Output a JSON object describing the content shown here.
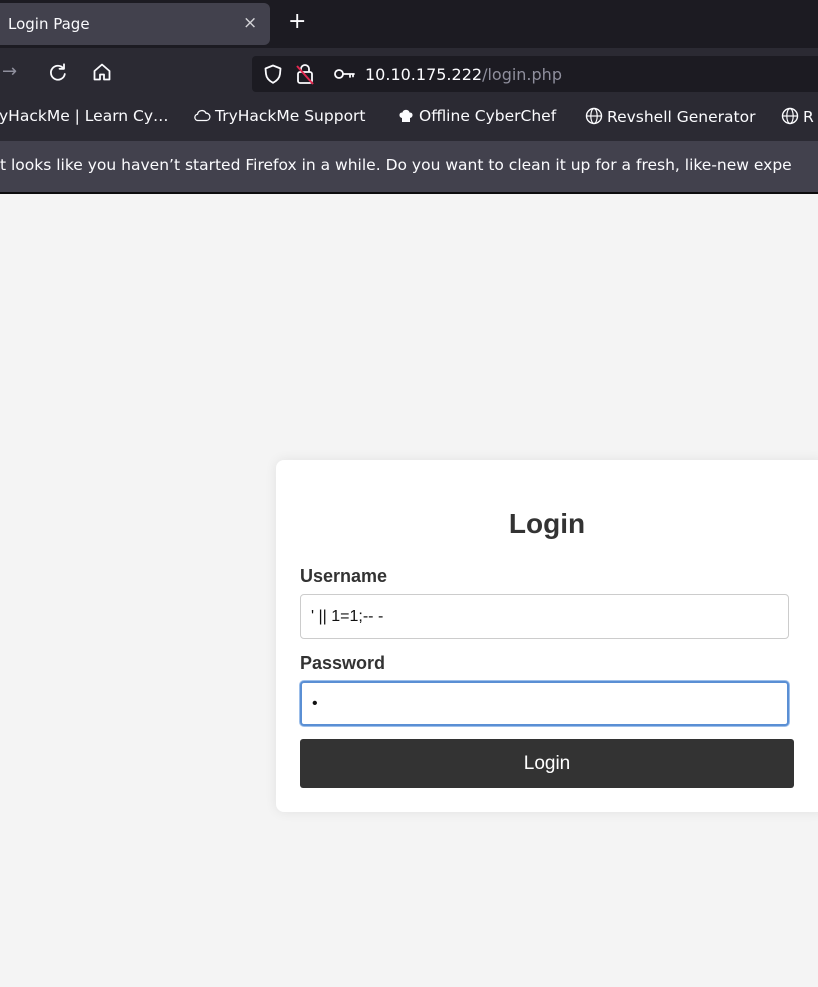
{
  "browser": {
    "tab": {
      "title": "Login Page",
      "close_glyph": "×"
    },
    "new_tab_glyph": "+",
    "nav": {
      "back_glyph": "→"
    },
    "url": {
      "host": "10.10.175.222",
      "path": "/login.php"
    },
    "bookmarks": [
      {
        "label": "yHackMe | Learn Cy…",
        "icon": ""
      },
      {
        "label": "TryHackMe Support",
        "icon": "cloud-icon"
      },
      {
        "label": "Offline CyberChef",
        "icon": "chef-hat-icon"
      },
      {
        "label": "Revshell Generator",
        "icon": "globe-icon"
      },
      {
        "label": "R",
        "icon": "globe-icon"
      }
    ],
    "notice": "t looks like you haven’t started Firefox in a while. Do you want to clean it up for a fresh, like-new expe"
  },
  "login": {
    "title": "Login",
    "username_label": "Username",
    "username_value": "' || 1=1;-- -",
    "password_label": "Password",
    "password_value": "x",
    "button_label": "Login"
  },
  "colors": {
    "page_bg": "#f4f4f4",
    "button_bg": "#333333",
    "focus_ring": "#5a8fd4",
    "tabbar_bg": "#1c1b22",
    "toolbar_bg": "#2b2a33"
  }
}
